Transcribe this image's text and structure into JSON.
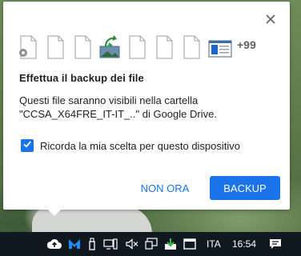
{
  "popup": {
    "more_count": "+99",
    "title": "Effettua il backup dei file",
    "description_line1": "Questi file saranno visibili nella cartella",
    "description_line2": "\"CCSA_X64FRE_IT-IT_..\" di Google Drive.",
    "remember_label": "Ricorda la mia scelta per questo dispositivo",
    "remember_checked": true,
    "cancel_label": "NON ORA",
    "backup_label": "BACKUP",
    "accent_color": "#1a73e8",
    "file_icons": [
      "settings-file-icon",
      "file-icon",
      "file-icon",
      "image-file-icon",
      "file-icon",
      "file-icon",
      "file-icon",
      "window-file-icon"
    ]
  },
  "taskbar": {
    "language": "ITA",
    "time": "16:54"
  }
}
